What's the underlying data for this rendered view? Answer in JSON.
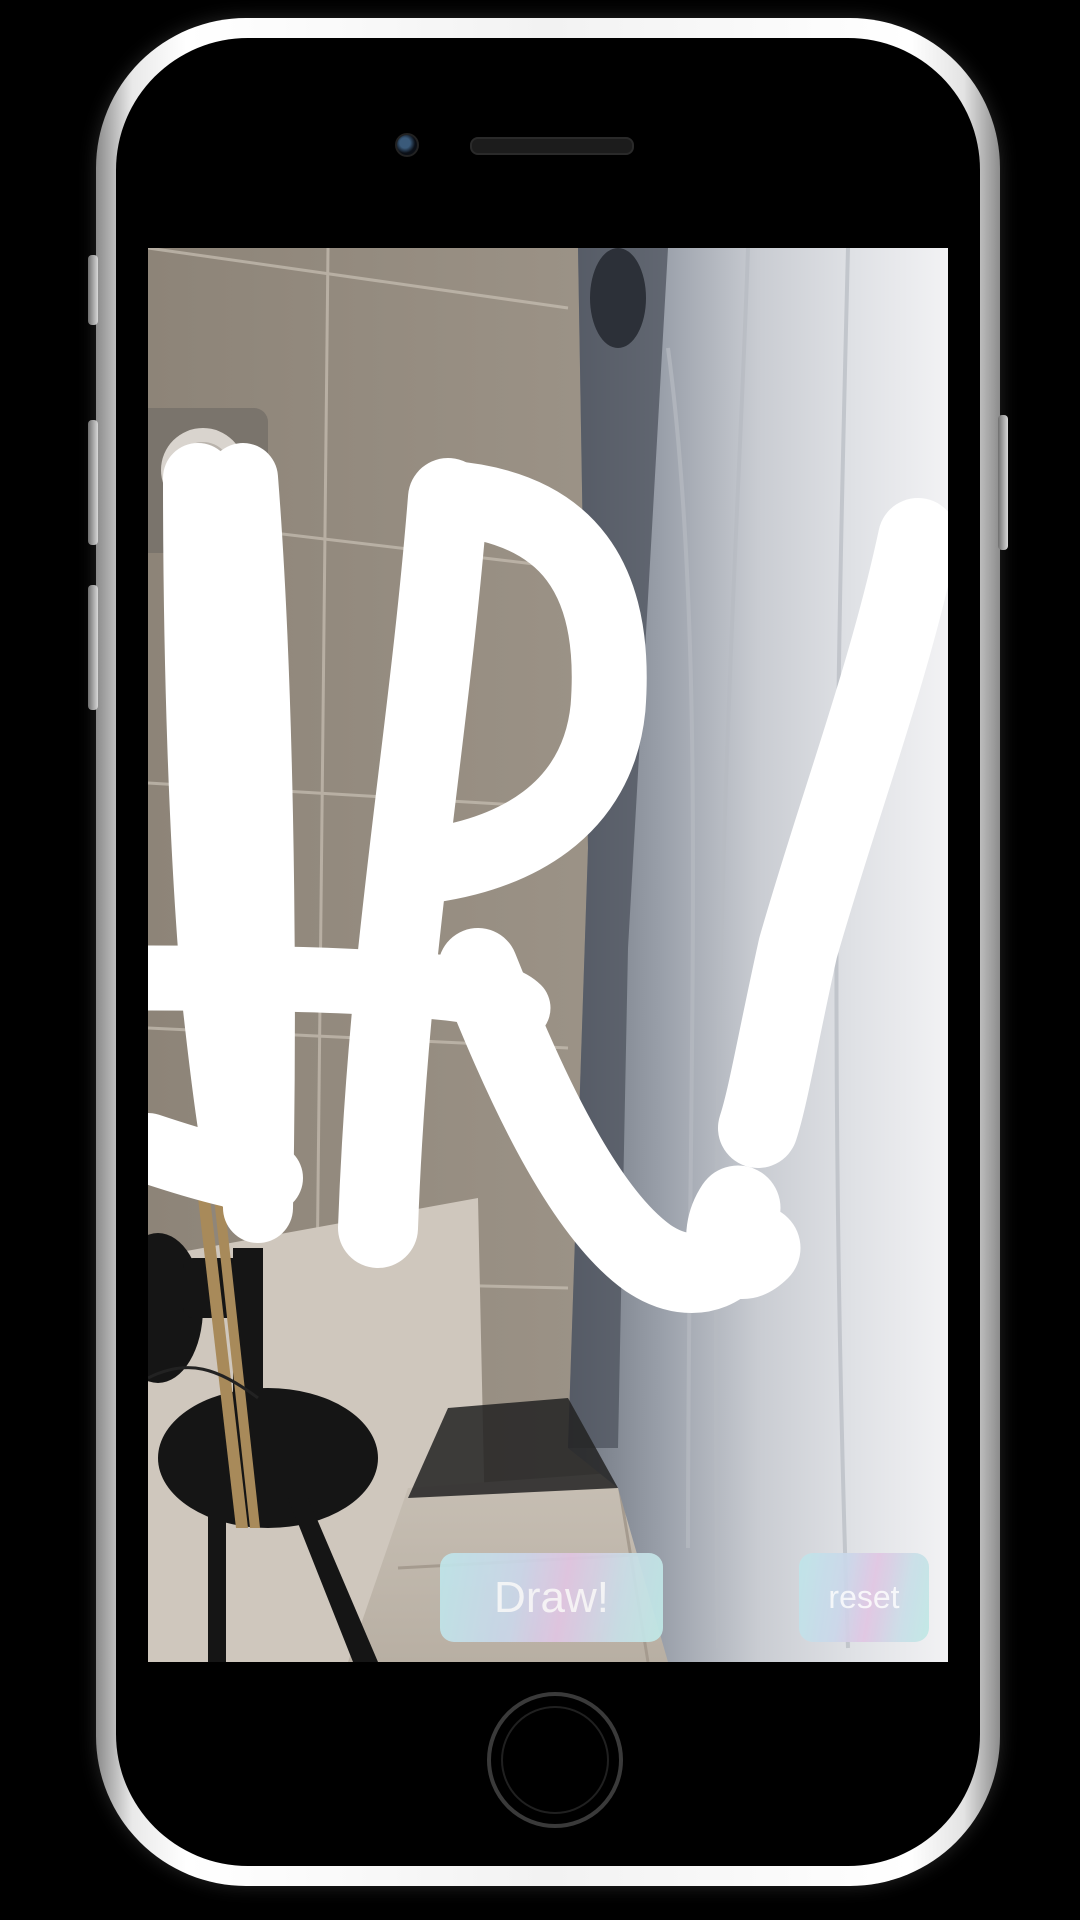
{
  "app": {
    "buttons": {
      "draw_label": "Draw!",
      "reset_label": "reset"
    }
  },
  "colors": {
    "button_gradient_start": "#bfe6ea",
    "button_gradient_mid": "#e1c6e3",
    "stroke": "#ffffff",
    "device_frame": "#f2f2f2"
  },
  "icons": [
    "camera-icon",
    "home-button-icon"
  ]
}
